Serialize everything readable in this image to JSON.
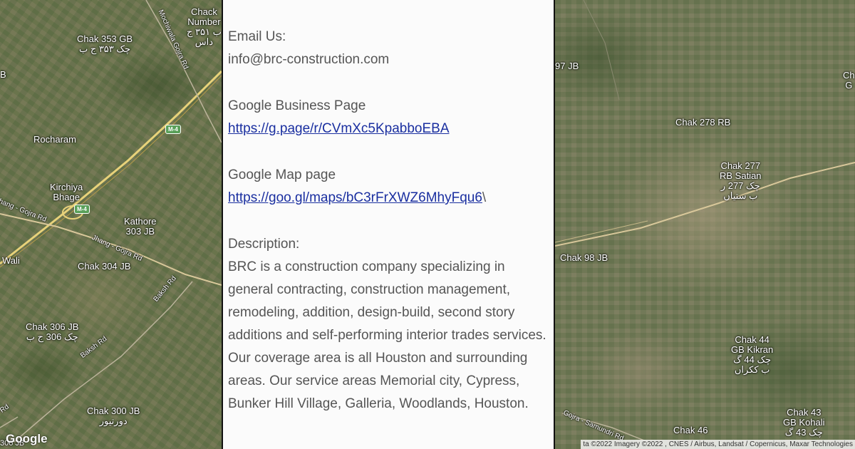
{
  "contact": {
    "email_heading": "Email Us:",
    "email": "info@brc-construction.com",
    "business_heading": "Google Business Page",
    "business_link": "https://g.page/r/CVmXc5KpabboEBA",
    "map_heading": "Google Map page",
    "map_link": "https://goo.gl/maps/bC3rFrXWZ6MhyFqu6",
    "map_link_suffix": "\\",
    "description_heading": "Description:",
    "description_text": "BRC is a construction company specializing in general contracting, construction management, remodeling, addition, design-build, second story additions and self-performing interior trades services. Our coverage area is all Houston and surrounding areas. Our service areas Memorial city, Cypress, Bunker Hill Village, Galleria, Woodlands, Houston."
  },
  "map_left": {
    "places": {
      "chak353": "Chak 353 GB\nچک ۳۵۳ ج ب",
      "chack_number": "Chack\nNumber\nب ۳۵۱ ج\nداس",
      "rocharam": "Rocharam",
      "kirchiya": "Kirchiya\nBhage",
      "kathore": "Kathore\n303 JB",
      "chak304": "Chak 304 JB",
      "wali": "Wali",
      "chak306": "Chak 306 JB\nچک 306 ج ب",
      "chak300": "Chak 300 JB\nدورتیور",
      "b_edge": "B",
      "jb_edge": "306 JB"
    },
    "roads": {
      "mochiwala": "Mochiwala Gojra Rd",
      "jhang_gojra_1": "hang - Gojra Rd",
      "jhang_gojra_2": "Jhang - Gojra Rd",
      "baksh_1": "Baksh Rd",
      "baksh_2": "Baksh Rd",
      "rd": "Rd"
    },
    "shields": {
      "m4_a": "M-4",
      "m4_b": "M-4"
    },
    "logo": "Google"
  },
  "map_right": {
    "places": {
      "jb97": "97 JB",
      "chak278": "Chak 278 RB",
      "chak277": "Chak 277\nRB Satian\nچک 277 ر\nب ستیاں",
      "chak98": "Chak 98 JB",
      "chak44": "Chak 44\nGB Kikran\nچک 44 گ\nب ککراں",
      "chak43": "Chak 43\nGB Kohali\nچک 43 گ",
      "chak46": "Chak 46",
      "edge_top": "Ch\nG"
    },
    "roads": {
      "gojra_samundri": "Gojra - Samundri Rd"
    },
    "attribution": "ta ©2022 Imagery ©2022 , CNES / Airbus, Landsat / Copernicus, Maxar Technologies"
  },
  "colors": {
    "link": "#1a2fa0",
    "text": "#555555",
    "panel_bg": "#fbfbfb",
    "motorway": "#e8d27a"
  }
}
